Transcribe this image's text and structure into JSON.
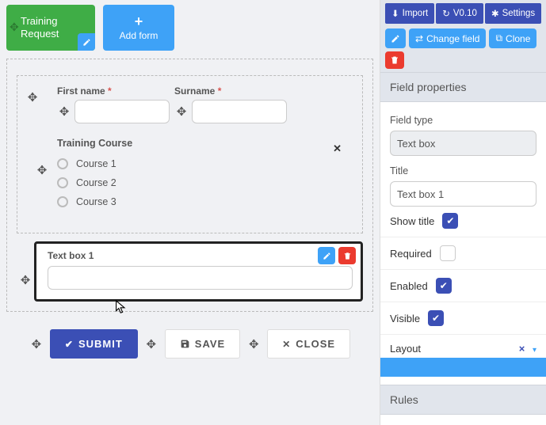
{
  "forms": {
    "active_form_title": "Training Request",
    "add_form_label": "Add form"
  },
  "fields": {
    "first_name_label": "First name",
    "surname_label": "Surname",
    "training_course_label": "Training Course",
    "courses": [
      "Course 1",
      "Course 2",
      "Course 3"
    ]
  },
  "selected_field": {
    "title": "Text box 1"
  },
  "buttons": {
    "submit": "SUBMIT",
    "save": "SAVE",
    "close": "CLOSE"
  },
  "sidebar": {
    "import": "Import",
    "version": "V0.10",
    "settings": "Settings",
    "change_field": "Change field",
    "clone": "Clone",
    "section_title": "Field properties",
    "field_type_label": "Field type",
    "field_type_value": "Text box",
    "title_label": "Title",
    "title_value": "Text box 1",
    "show_title_label": "Show title",
    "required_label": "Required",
    "enabled_label": "Enabled",
    "visible_label": "Visible",
    "layout_label": "Layout",
    "rules_title": "Rules"
  }
}
